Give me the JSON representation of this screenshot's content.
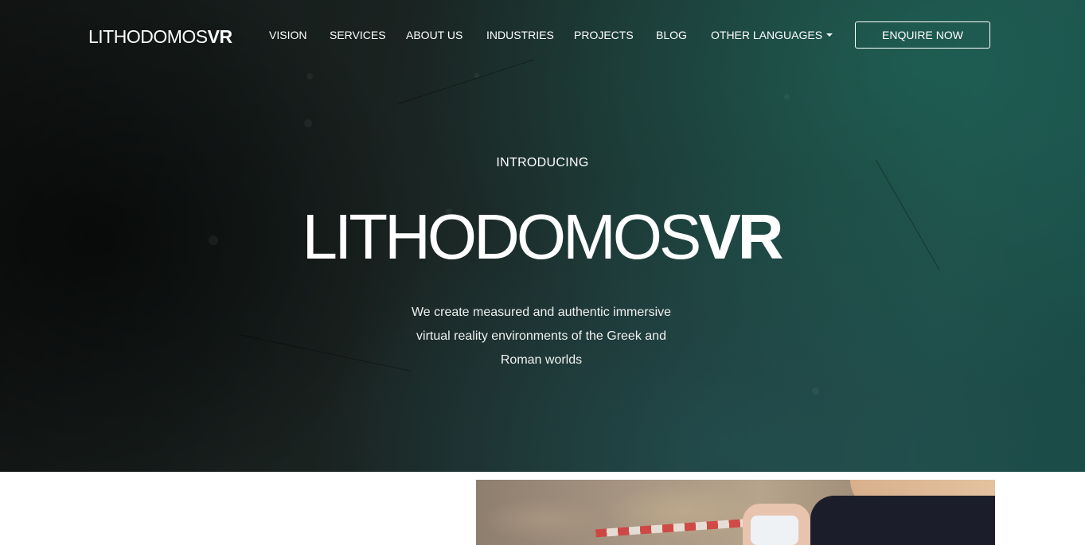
{
  "header": {
    "logo_light": "LITHODOMOS",
    "logo_bold": "VR",
    "nav": [
      {
        "label": "VISION"
      },
      {
        "label": "SERVICES"
      },
      {
        "label": "ABOUT US"
      },
      {
        "label": "INDUSTRIES"
      },
      {
        "label": "PROJECTS"
      },
      {
        "label": "BLOG"
      },
      {
        "label": "OTHER LANGUAGES",
        "dropdown": true
      }
    ],
    "cta_label": "ENQUIRE NOW"
  },
  "hero": {
    "eyebrow": "INTRODUCING",
    "title_light": "LITHODOMOS",
    "title_bold": "VR",
    "tagline_lines": [
      "We create measured and authentic immersive",
      "virtual reality environments of the Greek and",
      "Roman worlds"
    ]
  },
  "icons": {
    "dropdown": "caret-down-icon"
  },
  "colors": {
    "hero_dark": "#121514",
    "hero_teal": "#1f4a45",
    "text": "#ffffff"
  }
}
